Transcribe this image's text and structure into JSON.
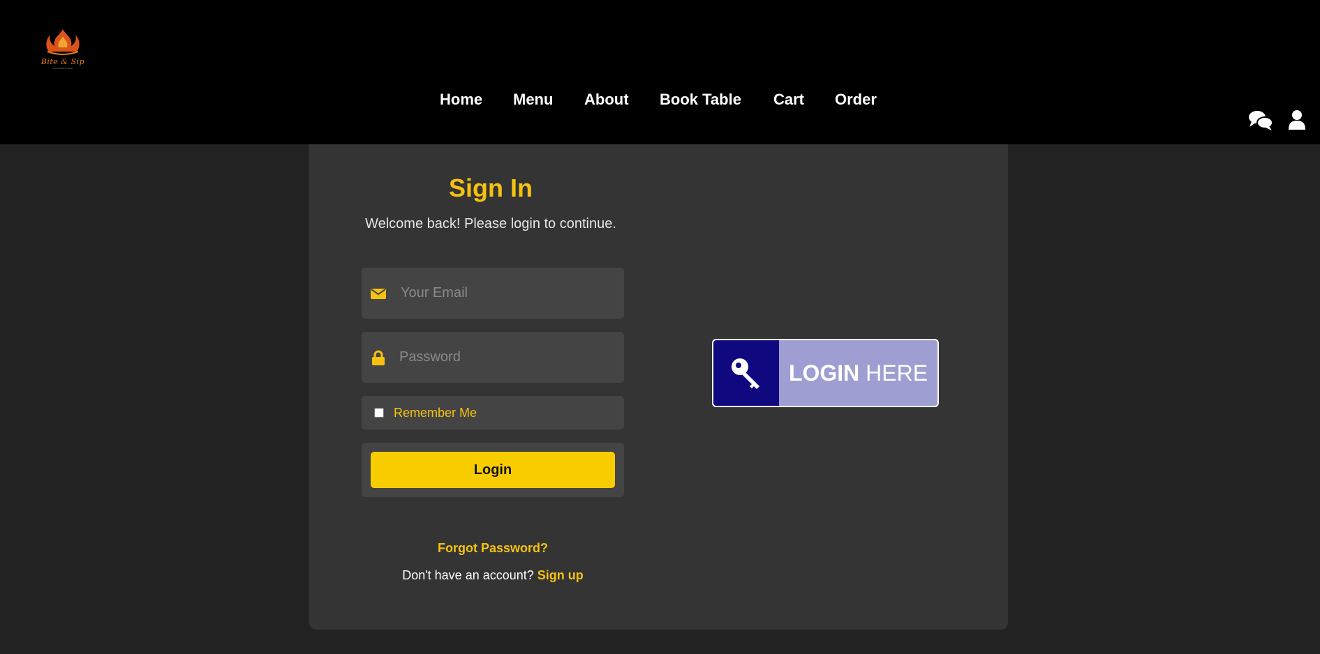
{
  "brand": {
    "name": "Bite & Sip",
    "tagline": "Lorem Dolor Sit Amet"
  },
  "nav": {
    "items": [
      "Home",
      "Menu",
      "About",
      "Book Table",
      "Cart",
      "Order"
    ]
  },
  "header_icons": [
    "chat-icon",
    "user-icon"
  ],
  "signin": {
    "title": "Sign In",
    "subtitle": "Welcome back! Please login to continue.",
    "email_placeholder": "Your Email",
    "password_placeholder": "Password",
    "remember_label": "Remember Me",
    "login_label": "Login",
    "forgot_label": "Forgot Password?",
    "no_account_text": "Don't have an account?",
    "signup_label": "Sign up"
  },
  "badge": {
    "bold": "LOGIN",
    "rest": "HERE"
  },
  "colors": {
    "accent": "#f5c211",
    "header_bg": "#000000",
    "page_bg": "#222222",
    "card_bg": "#343434",
    "field_bg": "#444444",
    "badge_dark": "#10087f",
    "badge_light": "#9e9ed2"
  }
}
